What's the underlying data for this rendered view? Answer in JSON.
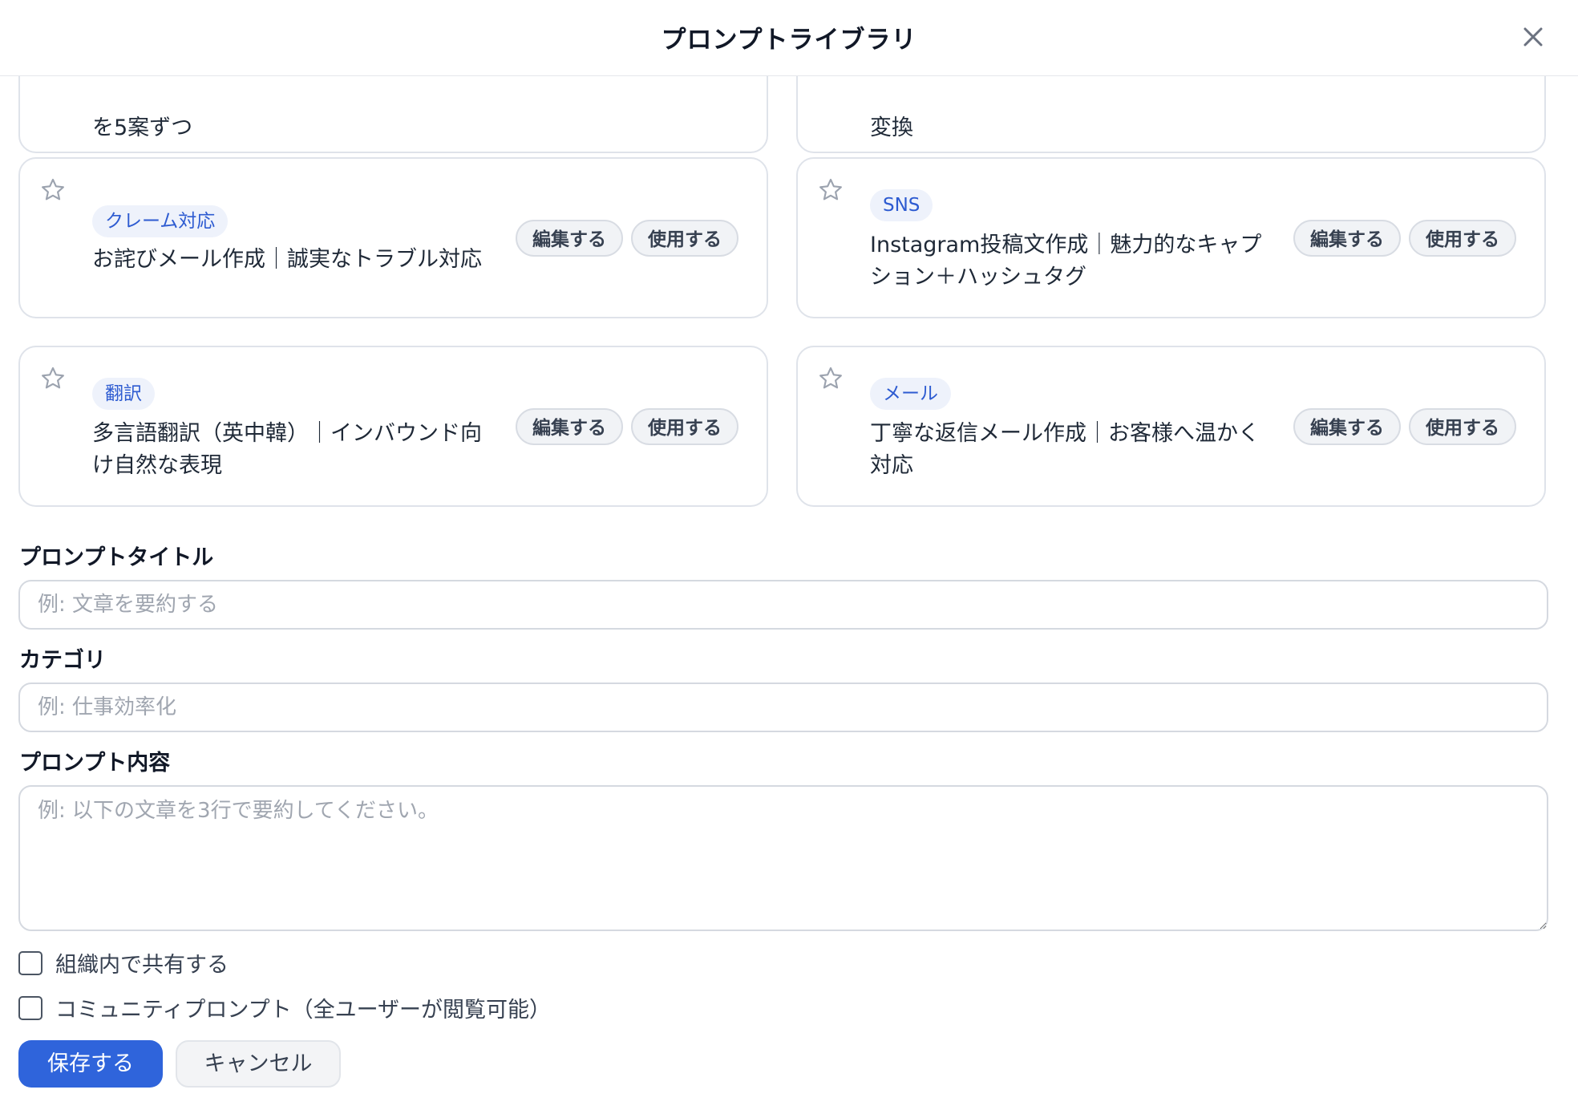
{
  "dialog": {
    "title": "プロンプトライブラリ",
    "close_icon": "close-icon"
  },
  "partial_cards": [
    {
      "text": "を5案ずつ"
    },
    {
      "text": "変換"
    }
  ],
  "cards": [
    {
      "category": "クレーム対応",
      "title": "お詫びメール作成｜誠実なトラブル対応",
      "edit_label": "編集する",
      "use_label": "使用する"
    },
    {
      "category": "SNS",
      "title": "Instagram投稿文作成｜魅力的なキャプション＋ハッシュタグ",
      "edit_label": "編集する",
      "use_label": "使用する"
    },
    {
      "category": "翻訳",
      "title": "多言語翻訳（英中韓）｜インバウンド向け自然な表現",
      "edit_label": "編集する",
      "use_label": "使用する"
    },
    {
      "category": "メール",
      "title": "丁寧な返信メール作成｜お客様へ温かく対応",
      "edit_label": "編集する",
      "use_label": "使用する"
    }
  ],
  "form": {
    "title_label": "プロンプトタイトル",
    "title_placeholder": "例: 文章を要約する",
    "title_value": "",
    "category_label": "カテゴリ",
    "category_placeholder": "例: 仕事効率化",
    "category_value": "",
    "content_label": "プロンプト内容",
    "content_placeholder": "例: 以下の文章を3行で要約してください。",
    "content_value": "",
    "share_label": "組織内で共有する",
    "share_checked": false,
    "community_label": "コミュニティプロンプト（全ユーザーが閲覧可能）",
    "community_checked": false,
    "save_label": "保存する",
    "cancel_label": "キャンセル"
  },
  "colors": {
    "accent": "#2f64db",
    "badge_bg": "#eef2fb",
    "badge_text": "#2d5bd1",
    "card_border": "#dfe3ea"
  }
}
